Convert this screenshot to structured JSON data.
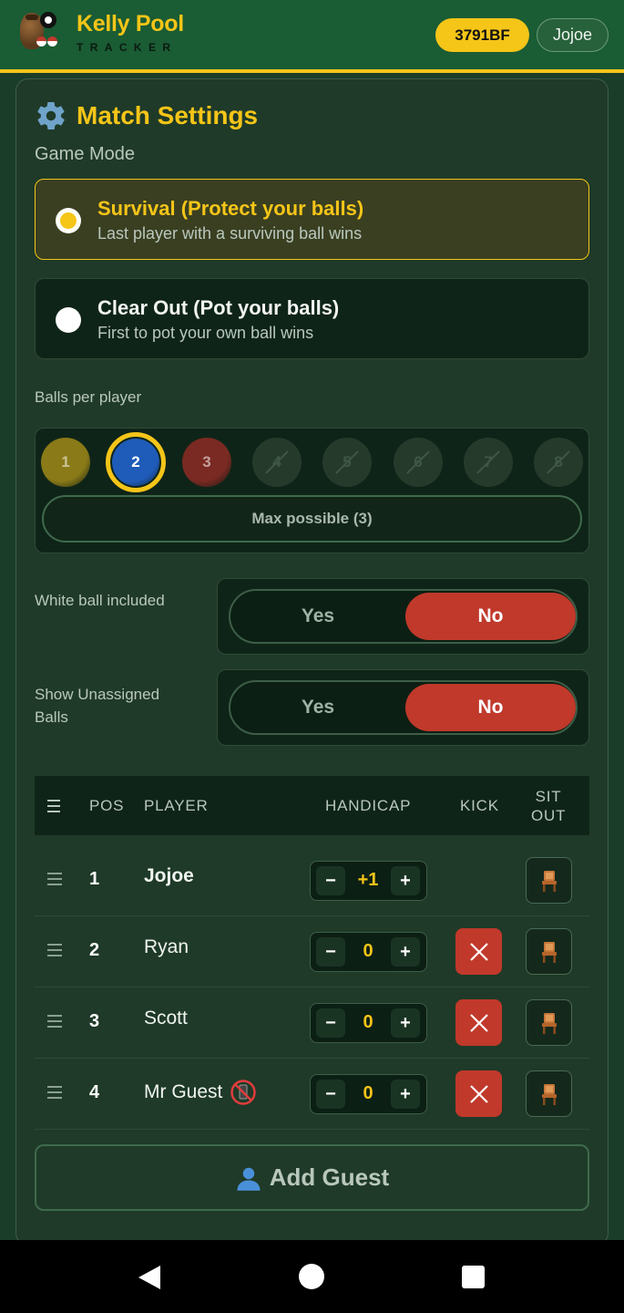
{
  "header": {
    "brand_title": "Kelly Pool",
    "brand_subtitle": "TRACKER",
    "match_code": "3791BF",
    "user_name": "Jojoe"
  },
  "settings": {
    "title": "Match Settings",
    "game_mode_label": "Game Mode",
    "modes": [
      {
        "title": "Survival (Protect your balls)",
        "desc": "Last player with a surviving ball wins",
        "selected": true
      },
      {
        "title": "Clear Out (Pot your balls)",
        "desc": "First to pot your own ball wins",
        "selected": false
      }
    ],
    "balls_label": "Balls per player",
    "balls": [
      {
        "n": "1",
        "color": "#8a7a18",
        "state": "available"
      },
      {
        "n": "2",
        "color": "#1f5bb8",
        "state": "selected"
      },
      {
        "n": "3",
        "color": "#7a2a22",
        "state": "available"
      },
      {
        "n": "4",
        "state": "disabled"
      },
      {
        "n": "5",
        "state": "disabled"
      },
      {
        "n": "6",
        "state": "disabled"
      },
      {
        "n": "7",
        "state": "disabled"
      },
      {
        "n": "8",
        "state": "disabled"
      }
    ],
    "max_button": "Max possible (3)",
    "white_ball_label": "White ball included",
    "white_ball": {
      "yes": "Yes",
      "no": "No",
      "value": "No"
    },
    "unassigned_label_1": "Show Unassigned",
    "unassigned_label_2": "Balls",
    "unassigned": {
      "yes": "Yes",
      "no": "No",
      "value": "No"
    }
  },
  "table": {
    "headers": {
      "pos": "POS",
      "player": "PLAYER",
      "handicap": "HANDICAP",
      "kick": "KICK",
      "sitout_1": "SIT",
      "sitout_2": "OUT"
    },
    "rows": [
      {
        "pos": "1",
        "name": "Jojoe",
        "handicap": "+1",
        "kick": false,
        "guest_phone": false
      },
      {
        "pos": "2",
        "name": "Ryan",
        "handicap": "0",
        "kick": true,
        "guest_phone": false
      },
      {
        "pos": "3",
        "name": "Scott",
        "handicap": "0",
        "kick": true,
        "guest_phone": false
      },
      {
        "pos": "4",
        "name": "Mr Guest",
        "handicap": "0",
        "kick": true,
        "guest_phone": true
      }
    ],
    "minus": "−",
    "plus": "+"
  },
  "add_guest": "Add Guest",
  "colors": {
    "accent": "#f5c518",
    "danger": "#c0392b",
    "header_bg": "#1a5c34"
  }
}
